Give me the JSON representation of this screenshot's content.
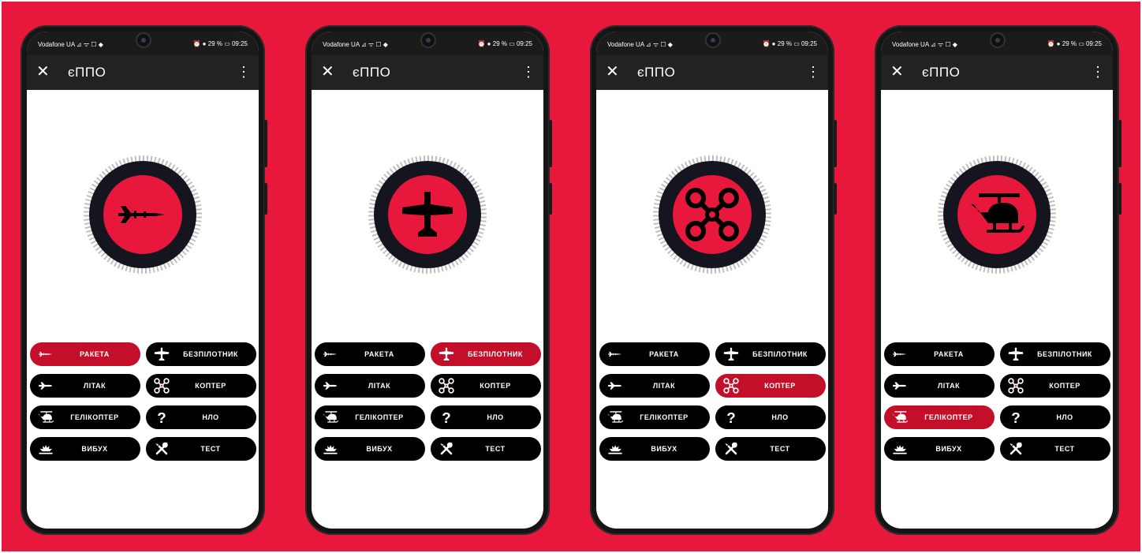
{
  "background_color": "#e8173c",
  "accent_color": "#c40f2a",
  "status_bar": {
    "carrier": "Vodafone UA ⊿ ᯤ ☐ ◆",
    "right": "⏰ ● 29 % ▭ 09:25"
  },
  "app_bar": {
    "close_icon": "✕",
    "title": "єППО",
    "menu_icon": "⋮"
  },
  "buttons": [
    {
      "id": "raketa",
      "label": "РАКЕТА",
      "icon": "missile-icon"
    },
    {
      "id": "bezpilotnyk",
      "label": "БЕЗПІЛОТНИК",
      "icon": "drone-plane-icon"
    },
    {
      "id": "litak",
      "label": "ЛІТАК",
      "icon": "airplane-icon"
    },
    {
      "id": "kopter",
      "label": "КОПТЕР",
      "icon": "quadcopter-icon"
    },
    {
      "id": "helikopter",
      "label": "ГЕЛІКОПТЕР",
      "icon": "helicopter-icon"
    },
    {
      "id": "nlo",
      "label": "НЛО",
      "icon": "question-icon"
    },
    {
      "id": "vybukh",
      "label": "ВИБУХ",
      "icon": "explosion-icon"
    },
    {
      "id": "test",
      "label": "ТЕСТ",
      "icon": "tools-icon"
    }
  ],
  "phones": [
    {
      "active_button": "raketa",
      "dial_icon": "missile-icon"
    },
    {
      "active_button": "bezpilotnyk",
      "dial_icon": "drone-plane-icon"
    },
    {
      "active_button": "kopter",
      "dial_icon": "quadcopter-icon"
    },
    {
      "active_button": "helikopter",
      "dial_icon": "helicopter-icon"
    }
  ]
}
